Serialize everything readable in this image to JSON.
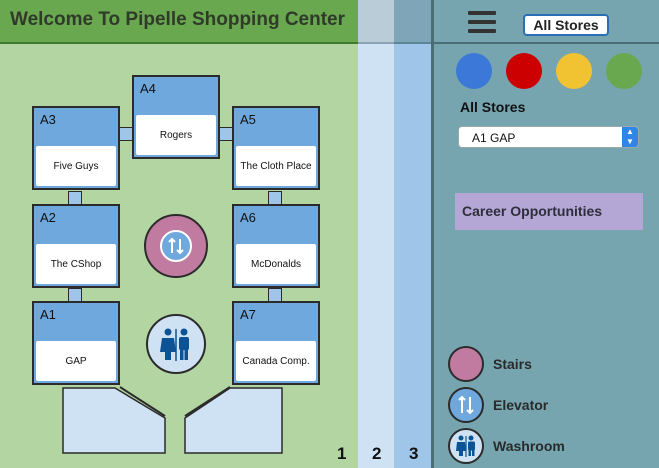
{
  "header": {
    "title": "Welcome To Pipelle Shopping Center"
  },
  "floors": [
    "1",
    "2",
    "3"
  ],
  "stores": [
    {
      "code": "A4",
      "name": "Rogers"
    },
    {
      "code": "A3",
      "name": "Five Guys"
    },
    {
      "code": "A5",
      "name": "The Cloth Place"
    },
    {
      "code": "A2",
      "name": "The CShop"
    },
    {
      "code": "A6",
      "name": "McDonalds"
    },
    {
      "code": "A1",
      "name": "GAP"
    },
    {
      "code": "A7",
      "name": "Canada Comp."
    }
  ],
  "icons": {
    "elevator": "up-down-arrows-icon",
    "washroom": "washroom-icon",
    "menu": "hamburger-menu-icon"
  },
  "panel": {
    "all_stores_button": "All Stores",
    "filter_colors": [
      "#3c78d8",
      "#cc0000",
      "#f1c232",
      "#6aa84f"
    ],
    "stores_label": "All Stores",
    "selected_store": "A1 GAP",
    "career_button": "Career Opportunities"
  },
  "legend": [
    {
      "label": "Stairs",
      "icon": "stairs-icon",
      "color": "#c27ba0"
    },
    {
      "label": "Elevator",
      "icon": "elevator-icon",
      "color": "#6fa8dc"
    },
    {
      "label": "Washroom",
      "icon": "washroom-icon",
      "color": "#cfe2f3"
    }
  ],
  "colors": {
    "map_bg": "#b3d5a2",
    "header_bg": "#6aa84f",
    "store_bg": "#6fa8dc",
    "panel_bg": "#76a5af",
    "career_bg": "#b4a7d6"
  }
}
